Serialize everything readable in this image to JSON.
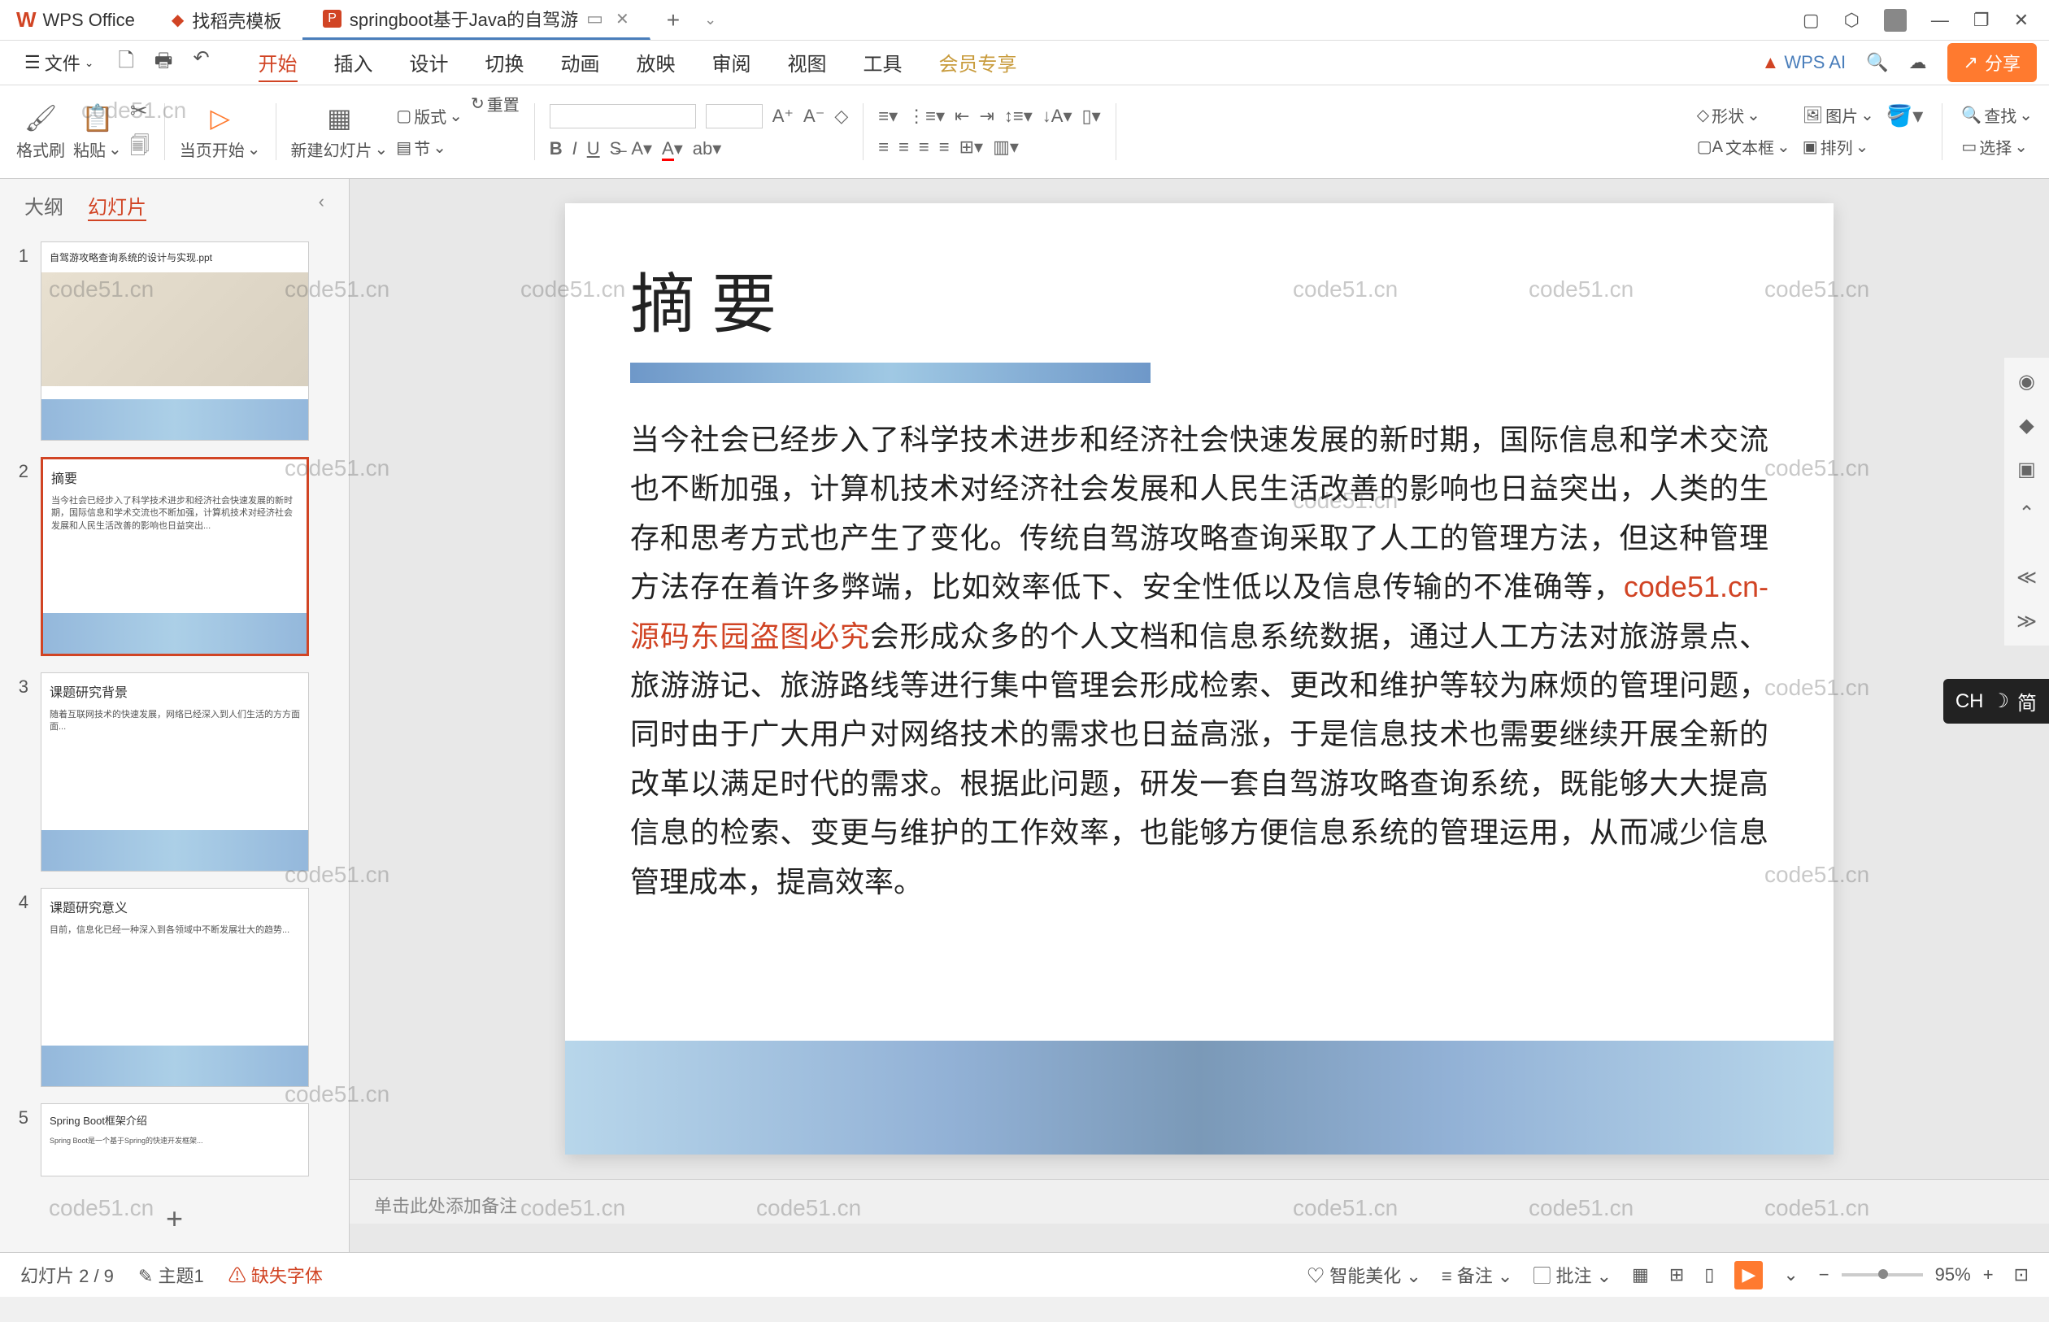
{
  "app": {
    "name": "WPS Office"
  },
  "tabs": [
    {
      "label": "找稻壳模板",
      "icon_color": "#d14424"
    },
    {
      "label": "springboot基于Java的自驾游",
      "icon": "P",
      "active": true
    }
  ],
  "window_controls": {
    "min": "—",
    "max": "❐",
    "close": "✕"
  },
  "menubar": {
    "file": "文件",
    "tabs": [
      "开始",
      "插入",
      "设计",
      "切换",
      "动画",
      "放映",
      "审阅",
      "视图",
      "工具",
      "会员专享"
    ],
    "active": "开始",
    "ai": "WPS AI",
    "share": "分享"
  },
  "ribbon": {
    "format_painter": "格式刷",
    "paste": "粘贴",
    "from_current": "当页开始",
    "new_slide": "新建幻灯片",
    "layout": "版式",
    "section": "节",
    "reset": "重置",
    "shape": "形状",
    "picture": "图片",
    "textbox": "文本框",
    "arrange": "排列",
    "find": "查找",
    "select": "选择"
  },
  "sidepanel": {
    "tab_outline": "大纲",
    "tab_slides": "幻灯片",
    "thumbs": [
      {
        "n": "1",
        "title": "自驾游攻略查询系统的设计与实现.ppt"
      },
      {
        "n": "2",
        "title": "摘要",
        "selected": true
      },
      {
        "n": "3",
        "title": "课题研究背景"
      },
      {
        "n": "4",
        "title": "课题研究意义"
      },
      {
        "n": "5",
        "title": "Spring Boot框架介绍"
      }
    ]
  },
  "slide": {
    "title": "摘 要",
    "body_pre": "当今社会已经步入了科学技术进步和经济社会快速发展的新时期，国际信息和学术交流也不断加强，计算机技术对经济社会发展和人民生活改善的影响也日益突出，人类的生存和思考方式也产生了变化。传统自驾游攻略查询采取了人工的管理方法，但这种管理方法存在着许多弊端，比如效率低下、安全性低以及信息传输的不准确等，",
    "body_red": "code51.cn-源码东园盗图必究",
    "body_post": "会形成众多的个人文档和信息系统数据，通过人工方法对旅游景点、旅游游记、旅游路线等进行集中管理会形成检索、更改和维护等较为麻烦的管理问题，同时由于广大用户对网络技术的需求也日益高涨，于是信息技术也需要继续开展全新的改革以满足时代的需求。根据此问题，研发一套自驾游攻略查询系统，既能够大大提高信息的检索、变更与维护的工作效率，也能够方便信息系统的管理运用，从而减少信息管理成本，提高效率。"
  },
  "notes": {
    "placeholder": "单击此处添加备注"
  },
  "status": {
    "slide_count": "幻灯片 2 / 9",
    "theme": "主题1",
    "missing_font": "缺失字体",
    "smart_beautify": "智能美化",
    "notes": "备注",
    "review": "批注",
    "zoom": "95%"
  },
  "ime": {
    "lang": "CH",
    "mode": "简"
  },
  "watermark": "code51.cn"
}
